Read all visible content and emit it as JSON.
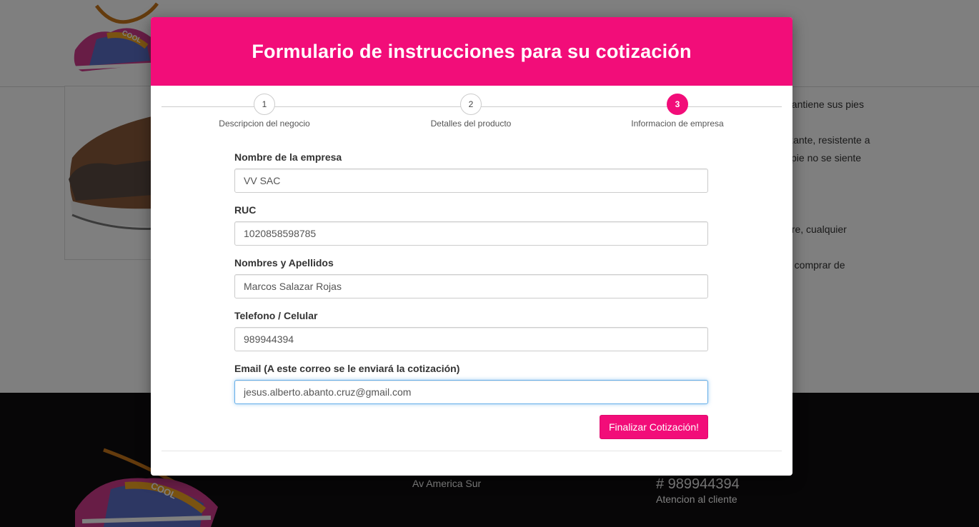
{
  "modal": {
    "title": "Formulario de instrucciones para su cotización",
    "steps": [
      {
        "number": "1",
        "label": "Descripcion del negocio"
      },
      {
        "number": "2",
        "label": "Detalles del producto"
      },
      {
        "number": "3",
        "label": "Informacion de empresa"
      }
    ],
    "fields": {
      "company_name": {
        "label": "Nombre de la empresa",
        "value": "VV SAC"
      },
      "ruc": {
        "label": "RUC",
        "value": "1020858598785"
      },
      "full_name": {
        "label": "Nombres y Apellidos",
        "value": "Marcos Salazar Rojas"
      },
      "phone": {
        "label": "Telefono / Celular",
        "value": "989944394"
      },
      "email": {
        "label": "Email (A este correo se le enviará la cotización)",
        "value": "jesus.alberto.abanto.cruz@gmail.com"
      }
    },
    "submit_label": "Finalizar Cotización!"
  },
  "background": {
    "description_fragments": [
      "nantiene sus pies",
      "izante, resistente a",
      "l pie no se siente",
      "bre, cualquier",
      "e comprar de"
    ],
    "footer": {
      "address": "Av America Sur",
      "phone": "# 989944394",
      "phone_caption": "Atencion al cliente"
    }
  },
  "colors": {
    "accent": "#f20d79",
    "footer_bg": "#0f0d0e",
    "focus_border": "#66afe9"
  }
}
